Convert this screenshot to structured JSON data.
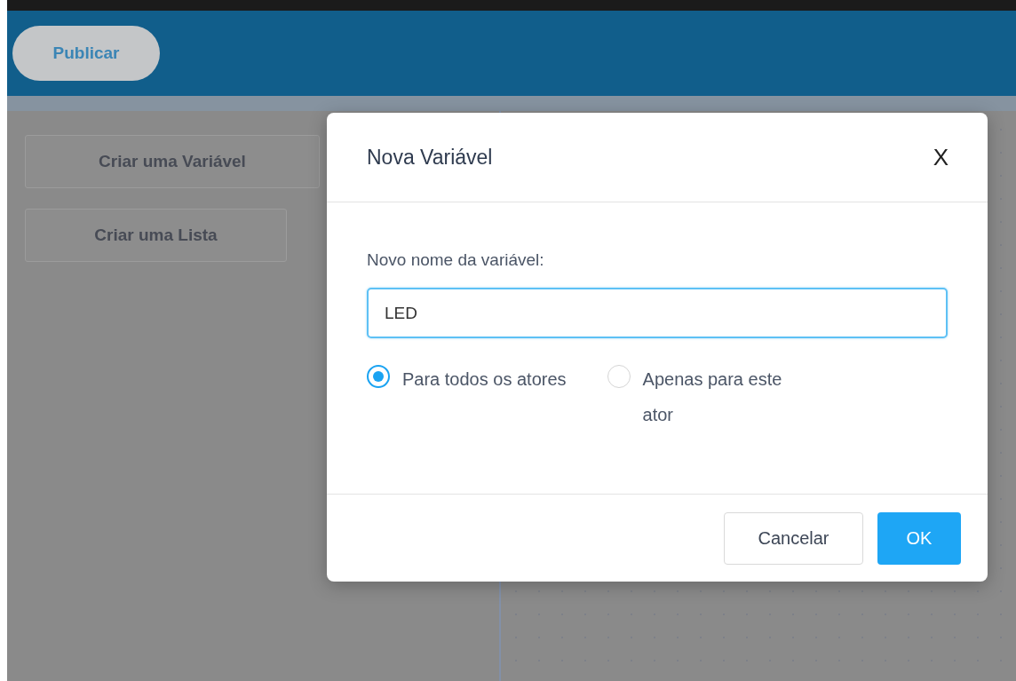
{
  "toolbar": {
    "publish_button": "Publicar"
  },
  "palette": {
    "buttons": [
      "Criar uma Variável",
      "Criar uma Lista"
    ]
  },
  "dialog": {
    "title": "Nova Variável",
    "close": "X",
    "field_label": "Novo nome da variável:",
    "field_value": "LED",
    "scope_options": [
      {
        "label": "Para todos os atores",
        "selected": true
      },
      {
        "label": "Apenas para este ator",
        "selected": false
      }
    ],
    "buttons": [
      {
        "label": "Cancelar",
        "kind": "secondary"
      },
      {
        "label": "OK",
        "kind": "primary"
      }
    ]
  }
}
